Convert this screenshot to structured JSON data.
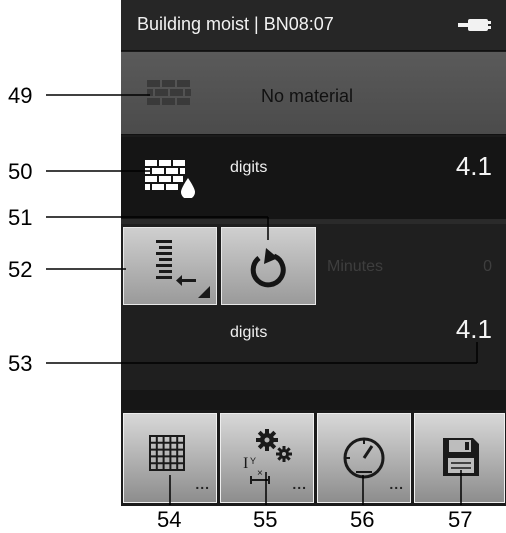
{
  "statusbar": {
    "title": "Building moist | BN08:07",
    "icon": "battery-icon"
  },
  "material": {
    "label": "No material",
    "icon": "brick-wall-icon"
  },
  "measurement1": {
    "unit_label": "digits",
    "value": "4.1",
    "icon": "brick-moisture-icon"
  },
  "controls": {
    "store_icon": "store-value-icon",
    "refresh_icon": "refresh-icon",
    "minutes_label": "Minutes",
    "minutes_value": "0"
  },
  "measurement2": {
    "unit_label": "digits",
    "value": "4.1"
  },
  "toolbar": {
    "buttons": [
      {
        "icon": "material-grid-icon",
        "dots": "..."
      },
      {
        "icon": "settings-gears-icon",
        "dots": "..."
      },
      {
        "icon": "gauge-icon",
        "dots": "..."
      },
      {
        "icon": "save-disk-icon"
      }
    ]
  },
  "callouts": {
    "c49": "49",
    "c50": "50",
    "c51": "51",
    "c52": "52",
    "c53": "53",
    "c54": "54",
    "c55": "55",
    "c56": "56",
    "c57": "57"
  }
}
